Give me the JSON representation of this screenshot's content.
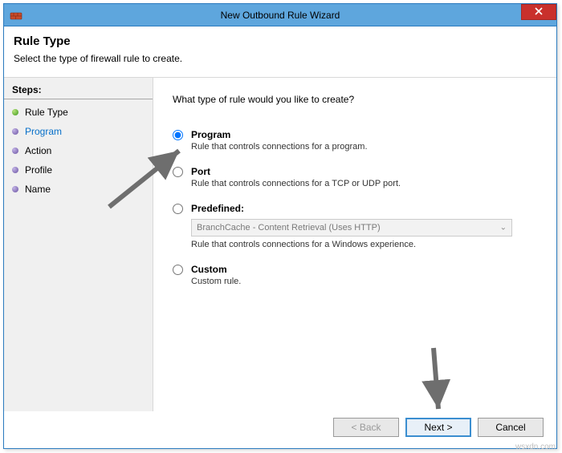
{
  "window": {
    "title": "New Outbound Rule Wizard"
  },
  "header": {
    "heading": "Rule Type",
    "subtitle": "Select the type of firewall rule to create."
  },
  "sidebar": {
    "steps_label": "Steps:",
    "items": [
      {
        "label": "Rule Type",
        "current": true
      },
      {
        "label": "Program"
      },
      {
        "label": "Action"
      },
      {
        "label": "Profile"
      },
      {
        "label": "Name"
      }
    ]
  },
  "main": {
    "question": "What type of rule would you like to create?",
    "options": {
      "program": {
        "label": "Program",
        "desc": "Rule that controls connections for a program."
      },
      "port": {
        "label": "Port",
        "desc": "Rule that controls connections for a TCP or UDP port."
      },
      "predefined": {
        "label": "Predefined:",
        "selected_value": "BranchCache - Content Retrieval (Uses HTTP)",
        "desc": "Rule that controls connections for a Windows experience."
      },
      "custom": {
        "label": "Custom",
        "desc": "Custom rule."
      }
    }
  },
  "footer": {
    "back": "< Back",
    "next": "Next >",
    "cancel": "Cancel"
  },
  "watermark": "wsxdn.com"
}
